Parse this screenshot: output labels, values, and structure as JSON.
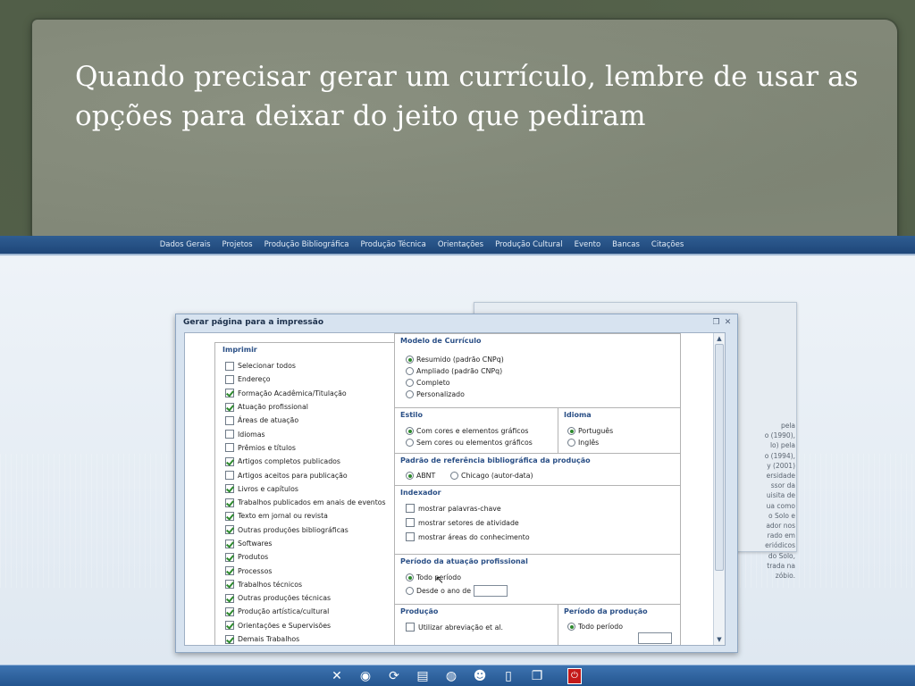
{
  "slide": {
    "title": "Quando precisar gerar um currículo, lembre de usar as opções para deixar do jeito que pediram"
  },
  "nav": [
    "Dados Gerais",
    "Projetos",
    "Produção Bibliográfica",
    "Produção Técnica",
    "Orientações",
    "Produção Cultural",
    "Evento",
    "Bancas",
    "Citações"
  ],
  "background_panel_lines": [
    "pela",
    "o (1990),",
    "lo) pela",
    "o (1994),",
    "y (2001)",
    "ersidade",
    "ssor da",
    "uisita de",
    "ua como",
    "o Solo e",
    "ador nos",
    "rado em",
    "eriódicos",
    "do Solo,",
    "trada na",
    "zóbio."
  ],
  "modal": {
    "title": "Gerar página para a impressão",
    "imprimir": {
      "title": "Imprimir",
      "items": [
        {
          "label": "Selecionar todos",
          "checked": false
        },
        {
          "label": "Endereço",
          "checked": false
        },
        {
          "label": "Formação Acadêmica/Titulação",
          "checked": true
        },
        {
          "label": "Atuação profissional",
          "checked": true
        },
        {
          "label": "Áreas de atuação",
          "checked": false
        },
        {
          "label": "Idiomas",
          "checked": false
        },
        {
          "label": "Prêmios e títulos",
          "checked": false
        },
        {
          "label": "Artigos completos publicados",
          "checked": true
        },
        {
          "label": "Artigos aceitos para publicação",
          "checked": false
        },
        {
          "label": "Livros e capítulos",
          "checked": true
        },
        {
          "label": "Trabalhos publicados em anais de eventos",
          "checked": true
        },
        {
          "label": "Texto em jornal ou revista",
          "checked": true
        },
        {
          "label": "Outras produções bibliográficas",
          "checked": true
        },
        {
          "label": "Softwares",
          "checked": true
        },
        {
          "label": "Produtos",
          "checked": true
        },
        {
          "label": "Processos",
          "checked": true
        },
        {
          "label": "Trabalhos técnicos",
          "checked": true
        },
        {
          "label": "Outras produções técnicas",
          "checked": true
        },
        {
          "label": "Produção artística/cultural",
          "checked": true
        },
        {
          "label": "Orientações e Supervisões",
          "checked": true
        },
        {
          "label": "Demais Trabalhos",
          "checked": true
        }
      ]
    },
    "modelo": {
      "title": "Modelo de Currículo",
      "options": [
        {
          "label": "Resumido (padrão CNPq)",
          "selected": true
        },
        {
          "label": "Ampliado (padrão CNPq)",
          "selected": false
        },
        {
          "label": "Completo",
          "selected": false
        },
        {
          "label": "Personalizado",
          "selected": false
        }
      ]
    },
    "estilo": {
      "title": "Estilo",
      "options": [
        {
          "label": "Com cores e elementos gráficos",
          "selected": true
        },
        {
          "label": "Sem cores ou elementos gráficos",
          "selected": false
        }
      ]
    },
    "idioma": {
      "title": "Idioma",
      "options": [
        {
          "label": "Português",
          "selected": true
        },
        {
          "label": "Inglês",
          "selected": false
        }
      ]
    },
    "padrao": {
      "title": "Padrão de referência bibliográfica da produção",
      "options": [
        {
          "label": "ABNT",
          "selected": true
        },
        {
          "label": "Chicago (autor-data)",
          "selected": false
        }
      ]
    },
    "indexador": {
      "title": "Indexador",
      "items": [
        {
          "label": "mostrar palavras-chave",
          "checked": false
        },
        {
          "label": "mostrar setores de atividade",
          "checked": false
        },
        {
          "label": "mostrar áreas do conhecimento",
          "checked": false
        }
      ]
    },
    "periodo_atuacao": {
      "title": "Período da atuação profissional",
      "options": [
        {
          "label": "Todo período",
          "selected": true
        },
        {
          "label": "Desde o ano de",
          "selected": false
        }
      ],
      "year_value": ""
    },
    "producao": {
      "title": "Produção",
      "items": [
        {
          "label": "Utilizar abreviação et al.",
          "checked": false
        }
      ]
    },
    "periodo_producao": {
      "title": "Período da produção",
      "options": [
        {
          "label": "Todo período",
          "selected": true
        }
      ]
    }
  },
  "taskbar": {
    "icons": [
      "tools-icon",
      "globe-icon",
      "refresh-icon",
      "printer-icon",
      "internet-icon",
      "users-icon",
      "document-icon",
      "windows-icon",
      "power-icon"
    ]
  },
  "colors": {
    "nav_bar": "#2f5d92",
    "section_title": "#2a4f86",
    "check_green": "#2d8a2d",
    "taskbar": "#3d74b1"
  }
}
